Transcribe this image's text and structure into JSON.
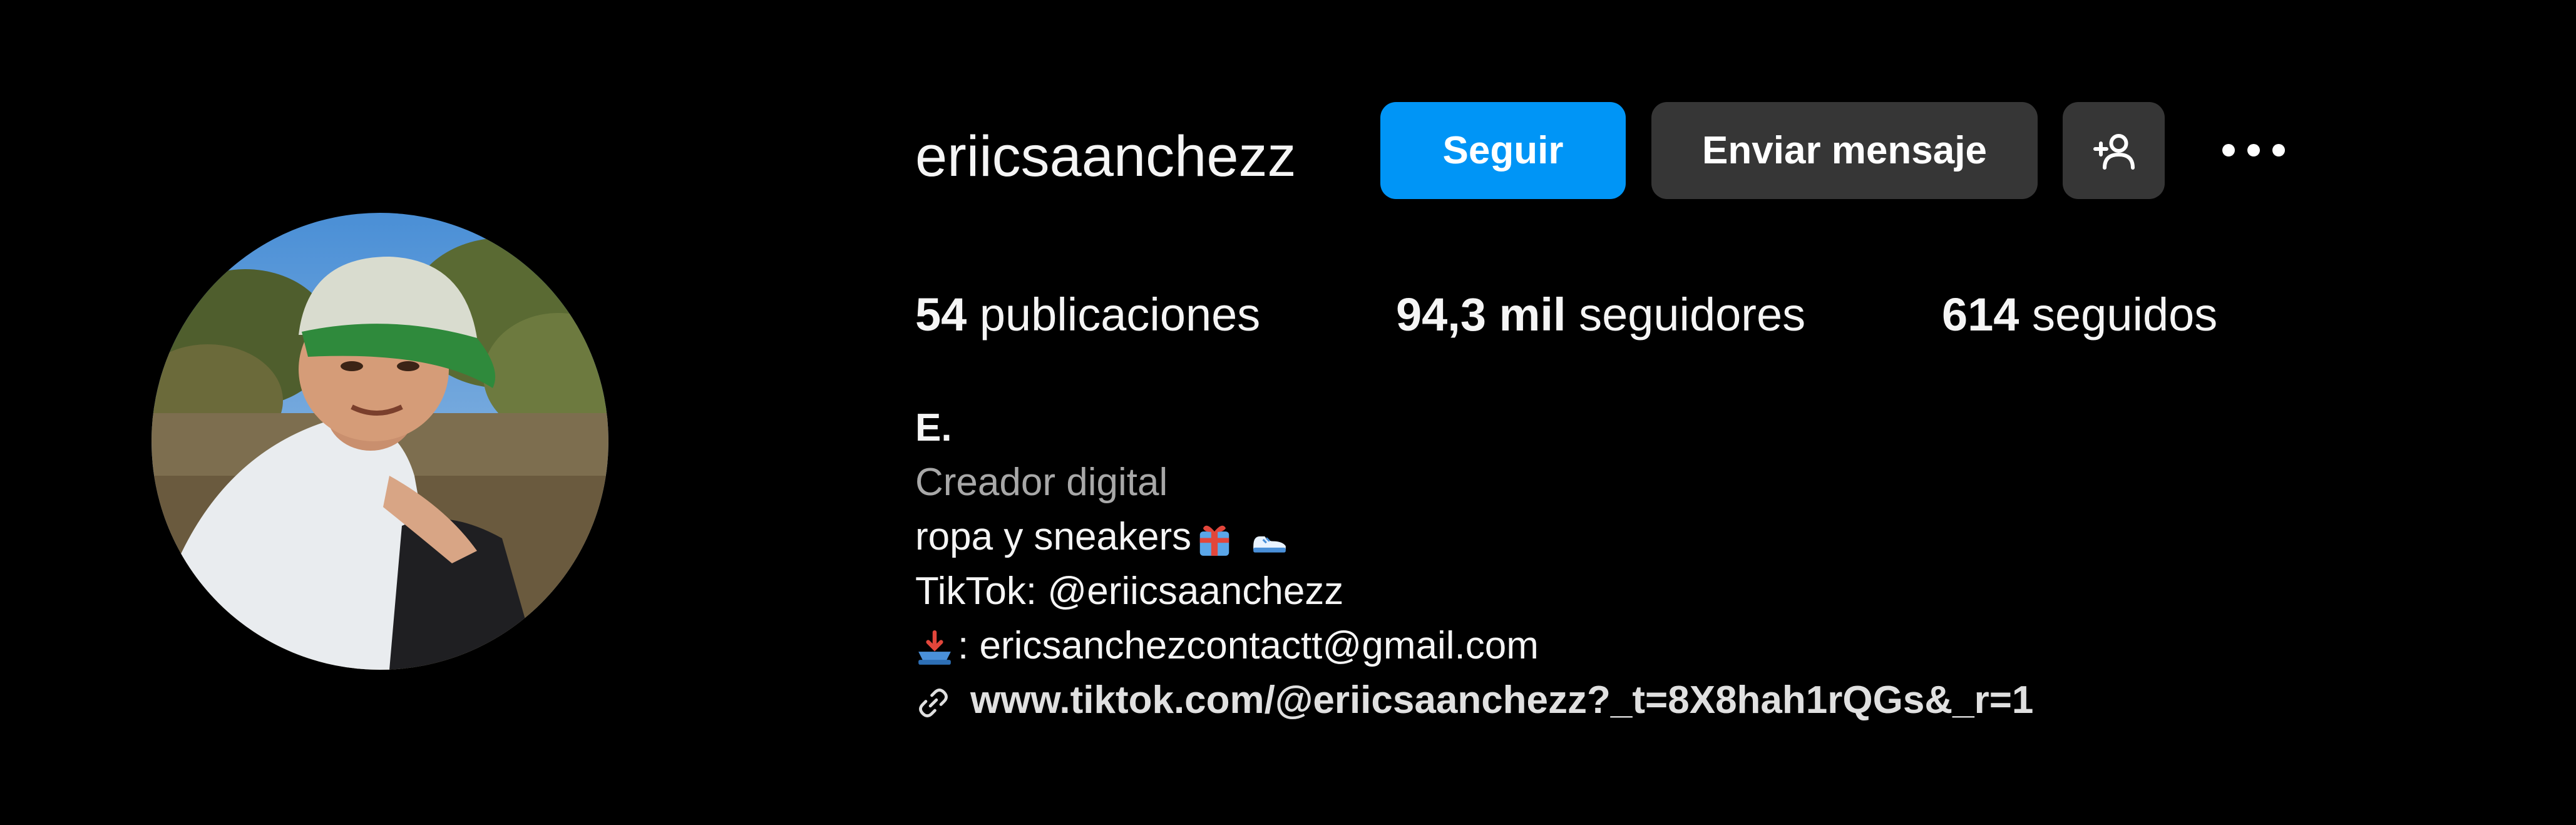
{
  "profile": {
    "username": "eriicsaanchezz",
    "avatar_icon": "profile-photo",
    "actions": {
      "follow_label": "Seguir",
      "message_label": "Enviar mensaje",
      "suggest_icon": "add-person-icon",
      "more_icon": "more-options-icon"
    },
    "stats": {
      "posts_count": "54",
      "posts_label": "publicaciones",
      "followers_count": "94,3 mil",
      "followers_label": "seguidores",
      "following_count": "614",
      "following_label": "seguidos"
    },
    "bio": {
      "name": "E.",
      "category": "Creador digital",
      "line1": "ropa y sneakers",
      "line1_emojis": [
        "gift-icon",
        "sneaker-icon"
      ],
      "line2": "TikTok: @eriicsaanchezz",
      "line3_icon": "inbox-tray-icon",
      "line3": ": ericsanchezcontactt@gmail.com",
      "link_icon": "link-icon",
      "link": "www.tiktok.com/@eriicsaanchezz?_t=8X8hah1rQGs&_r=1"
    }
  },
  "colors": {
    "background": "#000000",
    "primary_button": "#0095f6",
    "secondary_button": "#363636",
    "text": "#f5f5f5",
    "muted_text": "#a8a8a8"
  }
}
